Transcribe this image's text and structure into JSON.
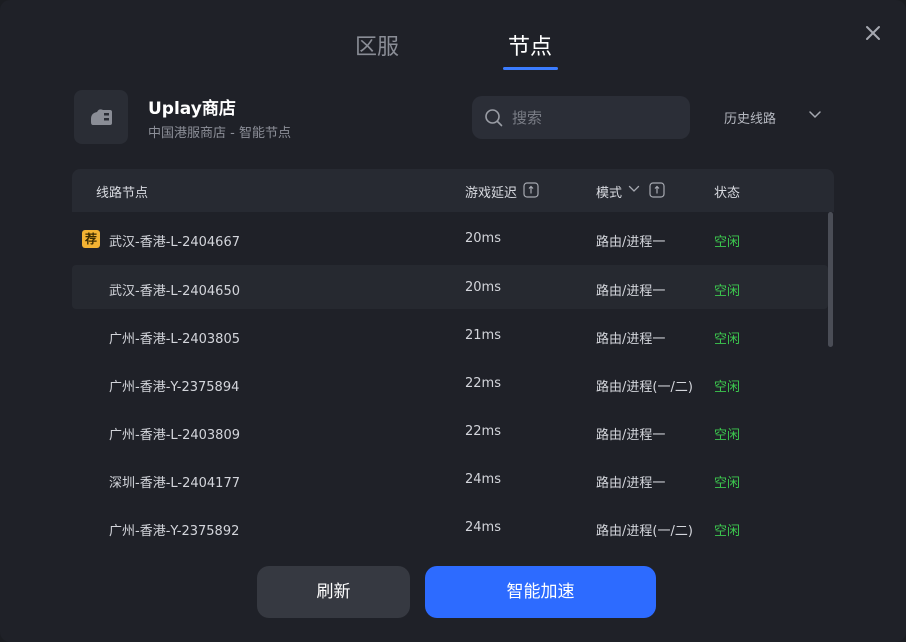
{
  "tabs": {
    "region": "区服",
    "node": "节点",
    "active": "节点"
  },
  "game": {
    "title": "Uplay商店",
    "subtitle": "中国港服商店 - 智能节点",
    "icon": "store-icon"
  },
  "search": {
    "placeholder": "搜索",
    "value": ""
  },
  "history": {
    "label": "历史线路"
  },
  "table": {
    "headers": {
      "node": "线路节点",
      "latency": "游戏延迟",
      "mode": "模式",
      "status": "状态"
    },
    "rows": [
      {
        "name": "武汉-香港-L-2404667",
        "latency": "20ms",
        "mode": "路由/进程一",
        "status": "空闲",
        "recommended": true,
        "badge": "荐"
      },
      {
        "name": "武汉-香港-L-2404650",
        "latency": "20ms",
        "mode": "路由/进程一",
        "status": "空闲",
        "recommended": false,
        "highlighted": true
      },
      {
        "name": "广州-香港-L-2403805",
        "latency": "21ms",
        "mode": "路由/进程一",
        "status": "空闲"
      },
      {
        "name": "广州-香港-Y-2375894",
        "latency": "22ms",
        "mode": "路由/进程(一/二)",
        "status": "空闲"
      },
      {
        "name": "广州-香港-L-2403809",
        "latency": "22ms",
        "mode": "路由/进程一",
        "status": "空闲"
      },
      {
        "name": "深圳-香港-L-2404177",
        "latency": "24ms",
        "mode": "路由/进程一",
        "status": "空闲"
      },
      {
        "name": "广州-香港-Y-2375892",
        "latency": "24ms",
        "mode": "路由/进程(一/二)",
        "status": "空闲"
      }
    ]
  },
  "buttons": {
    "refresh": "刷新",
    "accelerate": "智能加速"
  },
  "colors": {
    "accent": "#2d6bff",
    "status_idle": "#3cc74e",
    "badge": "#f2b233",
    "background": "#1f2128"
  }
}
